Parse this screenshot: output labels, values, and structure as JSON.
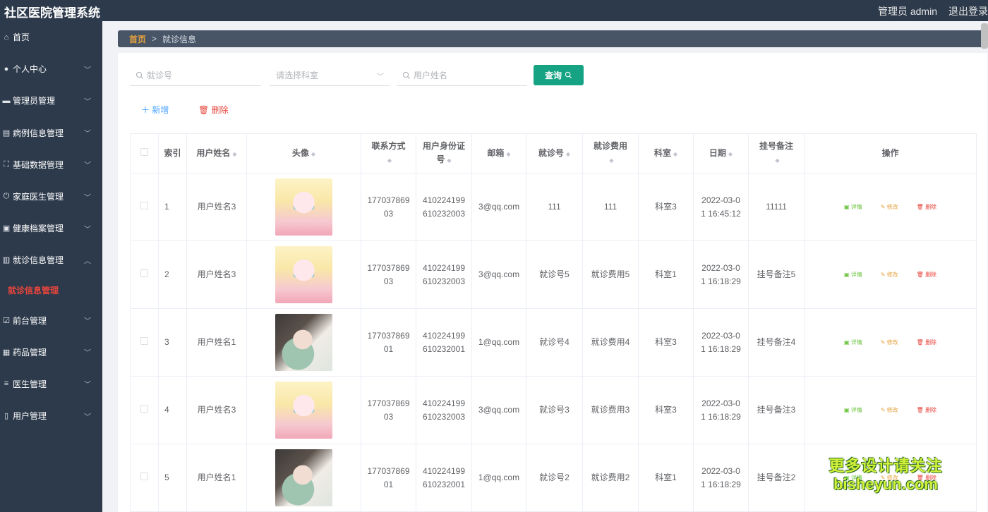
{
  "app": {
    "title": "社区医院管理系统",
    "admin_label": "管理员 admin",
    "logout": "退出登录"
  },
  "sidebar": {
    "items": [
      {
        "icon": "home-icon",
        "glyph": "⌂",
        "label": "首页",
        "chev": false
      },
      {
        "icon": "user-icon",
        "glyph": "●",
        "label": "个人中心",
        "chev": true
      },
      {
        "icon": "chat-icon",
        "glyph": "▬",
        "label": "管理员管理",
        "chev": true
      },
      {
        "icon": "document-icon",
        "glyph": "▤",
        "label": "病例信息管理",
        "chev": true
      },
      {
        "icon": "fullscreen-icon",
        "glyph": "⛶",
        "label": "基础数据管理",
        "chev": true
      },
      {
        "icon": "power-icon",
        "glyph": "⏻",
        "label": "家庭医生管理",
        "chev": true
      },
      {
        "icon": "id-card-icon",
        "glyph": "▣",
        "label": "健康档案管理",
        "chev": true
      },
      {
        "icon": "bar-chart-icon",
        "glyph": "▥",
        "label": "就诊信息管理",
        "chev": true,
        "open": true
      },
      {
        "icon": "calendar-check-icon",
        "glyph": "☑",
        "label": "前台管理",
        "chev": true
      },
      {
        "icon": "grid-icon",
        "glyph": "▦",
        "label": "药品管理",
        "chev": true
      },
      {
        "icon": "sliders-icon",
        "glyph": "≡",
        "label": "医生管理",
        "chev": true
      },
      {
        "icon": "phone-icon",
        "glyph": "▯",
        "label": "用户管理",
        "chev": true
      }
    ],
    "submenu_active": "就诊信息管理"
  },
  "breadcrumb": {
    "home": "首页",
    "separator": ">",
    "current": "就诊信息"
  },
  "search": {
    "visit_no_placeholder": "就诊号",
    "dept_placeholder": "请选择科室",
    "user_name_placeholder": "用户姓名",
    "query_button": "查询"
  },
  "actions": {
    "add": "新增",
    "delete": "删除"
  },
  "table": {
    "headers": {
      "index": "索引",
      "user_name": "用户姓名",
      "avatar": "头像",
      "phone_l1": "联系方式",
      "id_l1": "用户身份证",
      "id_l2": "号",
      "email": "邮箱",
      "visit_no": "就诊号",
      "fee_l1": "就诊费用",
      "dept": "科室",
      "date": "日期",
      "note_l1": "挂号备注",
      "ops": "操作"
    },
    "op_labels": {
      "view": "详情",
      "edit": "修改",
      "delete": "删除"
    },
    "rows": [
      {
        "index": "1",
        "user_name": "用户姓名3",
        "avatar": "blond",
        "phone_l1": "177037869",
        "phone_l2": "03",
        "id_l1": "410224199",
        "id_l2": "610232003",
        "email": "3@qq.com",
        "visit_no": "111",
        "fee": "111",
        "dept": "科室3",
        "date_l1": "2022-03-0",
        "date_l2": "1 16:45:12",
        "note": "11111"
      },
      {
        "index": "2",
        "user_name": "用户姓名3",
        "avatar": "blond",
        "phone_l1": "177037869",
        "phone_l2": "03",
        "id_l1": "410224199",
        "id_l2": "610232003",
        "email": "3@qq.com",
        "visit_no": "就诊号5",
        "fee": "就诊费用5",
        "dept": "科室1",
        "date_l1": "2022-03-0",
        "date_l2": "1 16:18:29",
        "note": "挂号备注5"
      },
      {
        "index": "3",
        "user_name": "用户姓名1",
        "avatar": "dark",
        "phone_l1": "177037869",
        "phone_l2": "01",
        "id_l1": "410224199",
        "id_l2": "610232001",
        "email": "1@qq.com",
        "visit_no": "就诊号4",
        "fee": "就诊费用4",
        "dept": "科室3",
        "date_l1": "2022-03-0",
        "date_l2": "1 16:18:29",
        "note": "挂号备注4"
      },
      {
        "index": "4",
        "user_name": "用户姓名3",
        "avatar": "blond",
        "phone_l1": "177037869",
        "phone_l2": "03",
        "id_l1": "410224199",
        "id_l2": "610232003",
        "email": "3@qq.com",
        "visit_no": "就诊号3",
        "fee": "就诊费用3",
        "dept": "科室3",
        "date_l1": "2022-03-0",
        "date_l2": "1 16:18:29",
        "note": "挂号备注3"
      },
      {
        "index": "5",
        "user_name": "用户姓名1",
        "avatar": "dark",
        "phone_l1": "177037869",
        "phone_l2": "01",
        "id_l1": "410224199",
        "id_l2": "610232001",
        "email": "1@qq.com",
        "visit_no": "就诊号2",
        "fee": "就诊费用2",
        "dept": "科室1",
        "date_l1": "2022-03-0",
        "date_l2": "1 16:18:29",
        "note": "挂号备注2"
      }
    ]
  },
  "watermark": {
    "line1": "更多设计请关注",
    "line2": "bisheyun.com"
  }
}
